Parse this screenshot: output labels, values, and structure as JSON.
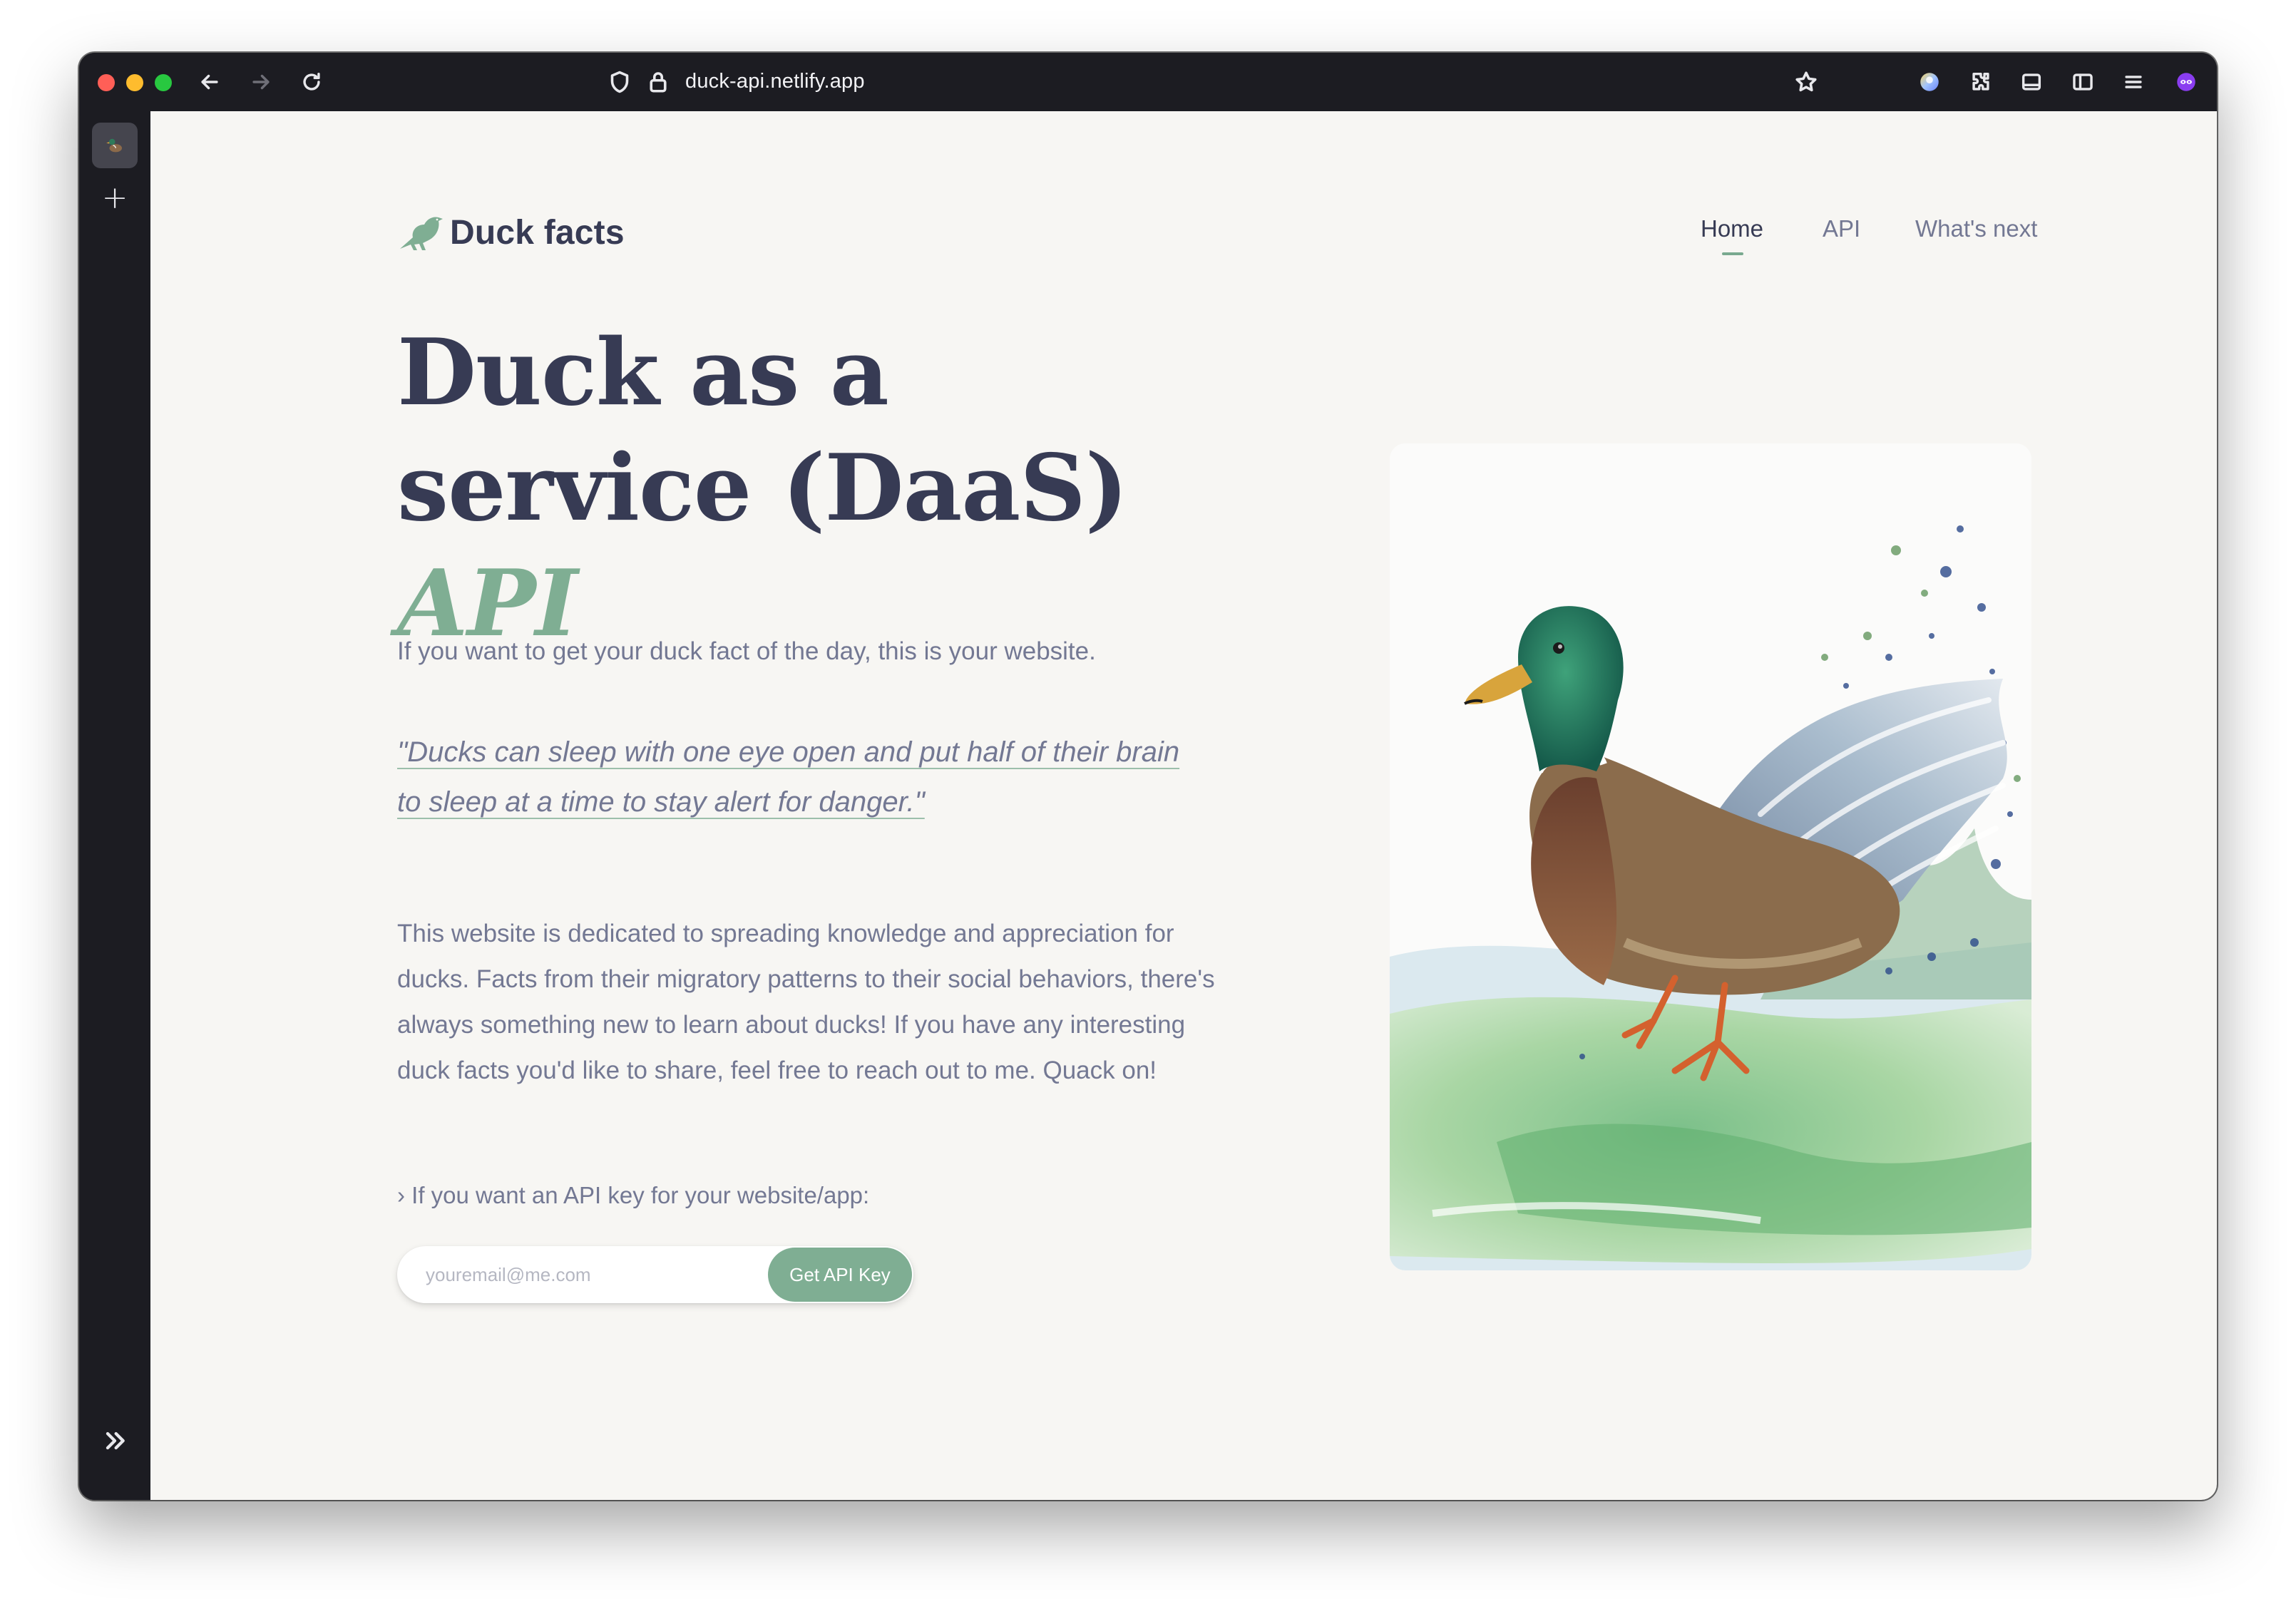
{
  "browser": {
    "url": "duck-api.netlify.app"
  },
  "colors": {
    "accent": "#7fae93",
    "heading": "#373b54",
    "body_text": "#737893",
    "page_background": "#f7f6f3"
  },
  "header": {
    "brand_name": "Duck facts",
    "brand_icon": "bird-icon",
    "nav": [
      {
        "label": "Home",
        "active": true
      },
      {
        "label": "API",
        "active": false
      },
      {
        "label": "What's next",
        "active": false
      }
    ]
  },
  "hero": {
    "title_main": "Duck as a service (DaaS)",
    "title_accent": "API",
    "lead": "If you want to get your duck fact of the day, this is your website.",
    "quote": "\"Ducks can sleep with one eye open and put half of their brain to sleep at a time to stay alert for danger.\"",
    "body": "This website is dedicated to spreading knowledge and appreciation for ducks. Facts from their migratory patterns to their social behaviors, there's always something new to learn about ducks! If you have any interesting duck facts you'd like to share, feel free to reach out to me. Quack on!"
  },
  "signup": {
    "prompt": "If you want an API key for your website/app:",
    "email_placeholder": "youremail@me.com",
    "button_label": "Get API Key"
  }
}
